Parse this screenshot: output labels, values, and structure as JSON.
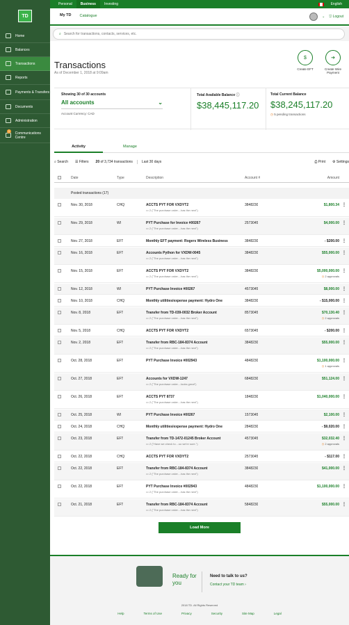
{
  "topbar": {
    "tabs": [
      "Personal",
      "Business",
      "Investing"
    ],
    "language": "English",
    "logout": "Logout"
  },
  "sidebar": {
    "logo": "TD",
    "items": [
      {
        "label": "Home",
        "icon": "home-icon"
      },
      {
        "label": "Balances",
        "icon": "balances-icon"
      },
      {
        "label": "Transactions",
        "icon": "transactions-icon"
      },
      {
        "label": "Reports",
        "icon": "reports-icon"
      },
      {
        "label": "Payments & Transfers",
        "icon": "payments-icon"
      },
      {
        "label": "Documents",
        "icon": "documents-icon"
      },
      {
        "label": "Administration",
        "icon": "administration-icon"
      },
      {
        "label": "Communications Centre",
        "icon": "communications-icon",
        "badge": "1"
      }
    ]
  },
  "subnav": {
    "tabs": [
      "My TD",
      "Catalogue"
    ]
  },
  "search": {
    "placeholder": "Search for transactions, contacts, services, etc."
  },
  "page": {
    "title": "Transactions",
    "date": "As of December 1, 2018 at 9:09am"
  },
  "quick_actions": [
    {
      "label": "Create EFT"
    },
    {
      "label": "Create Wire Payment"
    }
  ],
  "summary": {
    "showing": "Showing 30 of 30 accounts",
    "account_select": "All accounts",
    "currency": "Account Currency: CAD",
    "available_label": "Total Available Balance",
    "available_value": "$38,445,117.20",
    "current_label": "Total Current Balance",
    "current_value": "$38,245,117.20",
    "pending": "5 pending transactions"
  },
  "tabs": [
    "Activity",
    "Manage"
  ],
  "toolbar": {
    "search": "Search",
    "filters": "Filters",
    "count_bold": "20",
    "count": "of 3,734 transactions",
    "range": "Last 30 days",
    "print": "Print",
    "settings": "Settings"
  },
  "table": {
    "columns": [
      "Date",
      "Type",
      "Description",
      "Account #",
      "Amount"
    ],
    "group": "Posted transactions (17)",
    "rows": [
      {
        "date": "Nov. 30, 2018",
        "type": "CHQ",
        "desc": "ACCTS PYT FOR VXDYT2",
        "comment": "2 (\"The purchase order....has the next\")",
        "account": "3848230",
        "amount": "$1,800.34",
        "sign": "pos",
        "approvals": ""
      },
      {
        "date": "Nov. 29, 2018",
        "type": "WI",
        "desc": "PYT Purchase for Invoice #00267",
        "comment": "2 (\"The purchase order....has the next\")",
        "account": "2573045",
        "amount": "$4,000.00",
        "sign": "pos",
        "approvals": ""
      },
      {
        "date": "Nov. 27, 2018",
        "type": "EFT",
        "desc": "Monthly EFT payment: Rogers Wireless Business",
        "comment": "",
        "account": "3848230",
        "amount": "- $200.00",
        "sign": "neg",
        "approvals": ""
      },
      {
        "date": "Nov. 16, 2018",
        "type": "EFT",
        "desc": "Accounts Python for VXDW-0045",
        "comment": "2 (\"The purchase order....has the next\")",
        "account": "3848230",
        "amount": "$55,000.00",
        "sign": "pos",
        "approvals": ""
      },
      {
        "date": "Nov. 15, 2018",
        "type": "EFT",
        "desc": "ACCTS PYT FOR VXDYT2",
        "comment": "2 (\"The purchase order....has the next\")",
        "account": "3848230",
        "amount": "$5,000,000.00",
        "sign": "pos",
        "approvals": "2 approvals"
      },
      {
        "date": "Nov. 12, 2018",
        "type": "WI",
        "desc": "PYT Purchase Invoice #00267",
        "comment": "",
        "account": "4573045",
        "amount": "$8,000.00",
        "sign": "pos",
        "approvals": ""
      },
      {
        "date": "Nov. 10, 2018",
        "type": "CHQ",
        "desc": "Monthly utilities/expense payment: Hydro One",
        "comment": "",
        "account": "3848230",
        "amount": "- $15,000.00",
        "sign": "neg",
        "approvals": ""
      },
      {
        "date": "Nov. 8, 2018",
        "type": "EFT",
        "desc": "Transfer from TD-039-0032 Broker Account",
        "comment": "2 (\"The purchase order....has the next\")",
        "account": "8573045",
        "amount": "$70,130.40",
        "sign": "pos",
        "approvals": "2 approvals"
      },
      {
        "date": "Nov. 5, 2018",
        "type": "CHQ",
        "desc": "ACCTS PYT FOR VXDYT2",
        "comment": "",
        "account": "6573045",
        "amount": "- $200.00",
        "sign": "neg",
        "approvals": ""
      },
      {
        "date": "Nov. 2, 2018",
        "type": "EFT",
        "desc": "Transfer from RBC-184-8374 Account",
        "comment": "2 (\"The purchase order....has the next\")",
        "account": "3848230",
        "amount": "$55,000.00",
        "sign": "pos",
        "approvals": ""
      },
      {
        "date": "Oct. 28, 2018",
        "type": "EFT",
        "desc": "PYT Purchase Invoice #002943",
        "comment": "",
        "account": "4848230",
        "amount": "$1,100,000.00",
        "sign": "pos",
        "approvals": "1 approvals"
      },
      {
        "date": "Oct. 27, 2018",
        "type": "EFT",
        "desc": "Accounts for VXDW-1247",
        "comment": "2 (\"The purchase order....looks great\")",
        "account": "6848230",
        "amount": "$51,124.00",
        "sign": "pos",
        "approvals": ""
      },
      {
        "date": "Oct. 26, 2018",
        "type": "EFT",
        "desc": "ACCTS PYT 8737",
        "comment": "2 (\"The purchase order....has the next\")",
        "account": "1848230",
        "amount": "$1,040,000.00",
        "sign": "pos",
        "approvals": ""
      },
      {
        "date": "Oct. 25, 2018",
        "type": "WI",
        "desc": "PYT Purchase Invoice #00267",
        "comment": "",
        "account": "1573045",
        "amount": "$2,100.00",
        "sign": "pos",
        "approvals": ""
      },
      {
        "date": "Oct. 24, 2018",
        "type": "CHQ",
        "desc": "Monthly utilities/expense payment: Hydro One",
        "comment": "",
        "account": "2848230",
        "amount": "- $9,020.00",
        "sign": "neg",
        "approvals": ""
      },
      {
        "date": "Oct. 23, 2018",
        "type": "EFT",
        "desc": "Transfer from TD-1472-01245 Broker Account",
        "comment": "2 (\"Have we check to....so we're sure.\")",
        "account": "4573045",
        "amount": "$32,032.40",
        "sign": "pos",
        "approvals": "2 approvals"
      },
      {
        "date": "Oct. 22, 2018",
        "type": "CHQ",
        "desc": "ACCTS PYT FOR VXDYT2",
        "comment": "",
        "account": "2573045",
        "amount": "- $117.00",
        "sign": "neg",
        "approvals": ""
      },
      {
        "date": "Oct. 22, 2018",
        "type": "EFT",
        "desc": "Transfer from RBC-184-8374 Account",
        "comment": "2 (\"The purchase order....has the next\")",
        "account": "3848230",
        "amount": "$41,000.00",
        "sign": "pos",
        "approvals": ""
      },
      {
        "date": "Oct. 22, 2018",
        "type": "EFT",
        "desc": "PYT Purchase Invoice #002943",
        "comment": "2 (\"The purchase order....has the next\")",
        "account": "4848230",
        "amount": "$1,100,000.00",
        "sign": "pos",
        "approvals": ""
      },
      {
        "date": "Oct. 21, 2018",
        "type": "EFT",
        "desc": "Transfer from RBC-184-8374 Account",
        "comment": "2 (\"The purchase order....has the next\")",
        "account": "5848230",
        "amount": "$55,000.00",
        "sign": "pos",
        "approvals": ""
      }
    ]
  },
  "load_more": "Load More",
  "footer": {
    "ready": "Ready for you",
    "talk": "Need to talk to us?",
    "contact": "Contact your TD team",
    "copyright": "2018 TD. All Rights Reserved",
    "links": [
      "Help",
      "Terms of Use",
      "Privacy",
      "Security",
      "Site Map",
      "Legal"
    ]
  }
}
